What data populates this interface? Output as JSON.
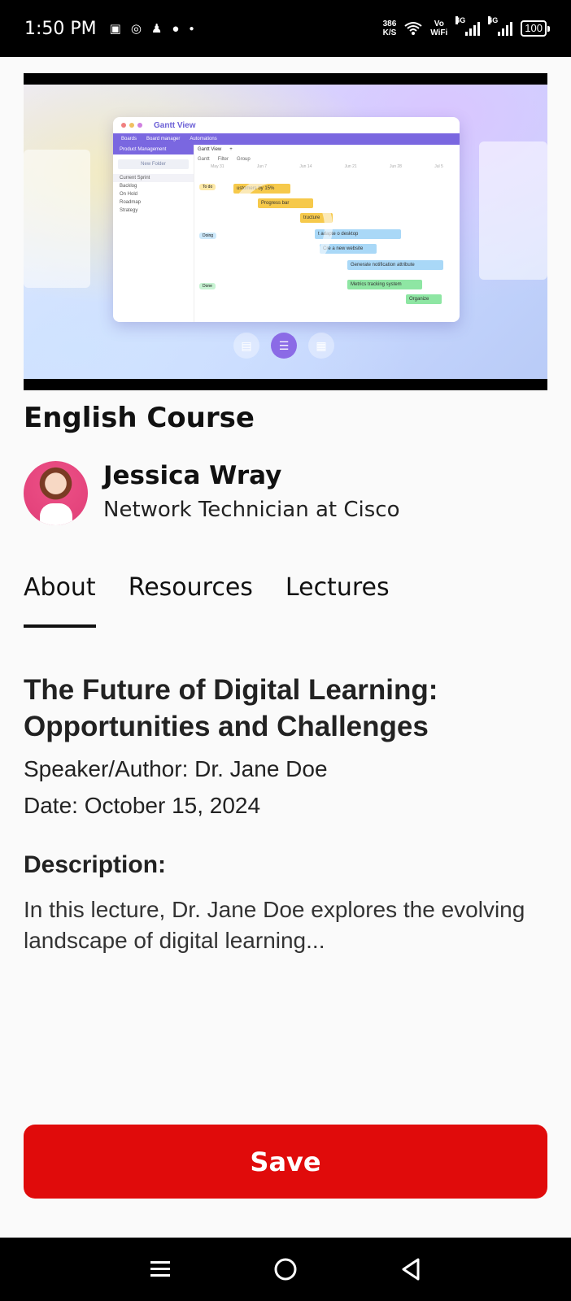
{
  "status_bar": {
    "time": "1:50 PM",
    "net_speed_value": "386",
    "net_speed_unit": "K/S",
    "vowifi_top": "Vo",
    "vowifi_bottom": "WiFi",
    "signal1_tag": "4G",
    "signal2_tag": "4G",
    "battery": "100"
  },
  "video": {
    "window_title": "Gantt View",
    "toolbar_items": [
      "Boards",
      "Board manager",
      "Automations"
    ],
    "sidebar_header": "Product Management",
    "new_folder": "New Folder",
    "sidebar_items": [
      "Current Sprint",
      "Backlog",
      "On Hold",
      "Roadmap",
      "Strategy"
    ],
    "view_tab": "Gantt View",
    "filters": [
      "Gantt",
      "Filter",
      "Group"
    ],
    "dates": [
      "May 31",
      "Jun 7",
      "Jun 14",
      "Jun 21",
      "Jun 28",
      "Jul 5"
    ],
    "lanes": [
      "To do",
      "Doing",
      "Done"
    ],
    "bars": [
      "ustomers by 15%",
      "Progress bar",
      "tructure",
      "t adapte  o desktop",
      "Cre  a new website",
      "Generate notification attribute",
      "Metrics tracking system",
      "Organize"
    ]
  },
  "course": {
    "title": "English Course"
  },
  "instructor": {
    "name": "Jessica Wray",
    "role": "Network Technician at Cisco"
  },
  "tabs": [
    {
      "label": "About",
      "active": true
    },
    {
      "label": "Resources",
      "active": false
    },
    {
      "label": "Lectures",
      "active": false
    }
  ],
  "lecture": {
    "title": "The Future of Digital Learning: Opportunities and Challenges",
    "author": "Speaker/Author: Dr. Jane Doe",
    "date": "Date: October 15, 2024",
    "description_heading": "Description:",
    "description": "In this lecture, Dr. Jane Doe explores the evolving landscape of digital learning..."
  },
  "actions": {
    "save_label": "Save"
  },
  "colors": {
    "save_button": "#e00b0b",
    "accent_purple": "#7a67e0"
  }
}
